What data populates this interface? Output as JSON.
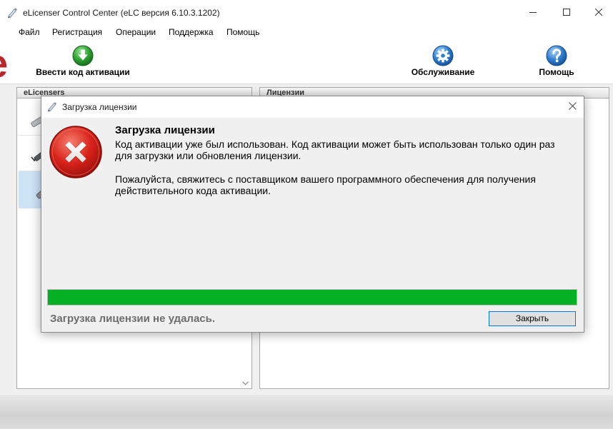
{
  "window": {
    "title": "eLicenser Control Center (eLC версия 6.10.3.1202)",
    "icon": "pen-icon",
    "controls": [
      "minimize-icon",
      "maximize-icon",
      "close-icon"
    ]
  },
  "menu": {
    "items": [
      {
        "label": "Файл"
      },
      {
        "label": "Регистрация"
      },
      {
        "label": "Операции"
      },
      {
        "label": "Поддержка"
      },
      {
        "label": "Помощь"
      }
    ]
  },
  "toolbar": {
    "logo_text": "e",
    "buttons": [
      {
        "label": "Ввести код активации",
        "icon": "download-arrow-icon"
      },
      {
        "label": "Обслуживание",
        "icon": "gear-icon"
      },
      {
        "label": "Помощь",
        "icon": "question-icon"
      }
    ]
  },
  "panels": {
    "elicensers": {
      "header": "eLicensers",
      "items": [
        {
          "icon": "usb-key-icon",
          "selected": false
        },
        {
          "icon": "usb-key-icon",
          "selected": false
        },
        {
          "icon": "usb-key-icon",
          "selected": true
        }
      ]
    },
    "licenses": {
      "header": "Лицензии"
    }
  },
  "dialog": {
    "title": "Загрузка лицензии",
    "icon": "error-icon",
    "heading": "Загрузка лицензии",
    "paragraphs": [
      {
        "lines": [
          "Код активации уже был использован. Код активации может быть использован только один раз",
          "для загрузки или обновления лицензии."
        ]
      },
      {
        "lines": [
          "Пожалуйста, свяжитесь с поставщиком вашего программного обеспечения для получения",
          "действительного кода активации."
        ]
      }
    ],
    "progress_percent": 100,
    "status_text": "Загрузка лицензии не удалась.",
    "close_label": "Закрыть"
  },
  "colors": {
    "logo_red": "#b8262b",
    "progress_fill": "#06b025",
    "error_red": "#d8231b",
    "selection": "#cde4f7",
    "button_focus": "#0078d7",
    "status_text": "#6d6d6d"
  }
}
